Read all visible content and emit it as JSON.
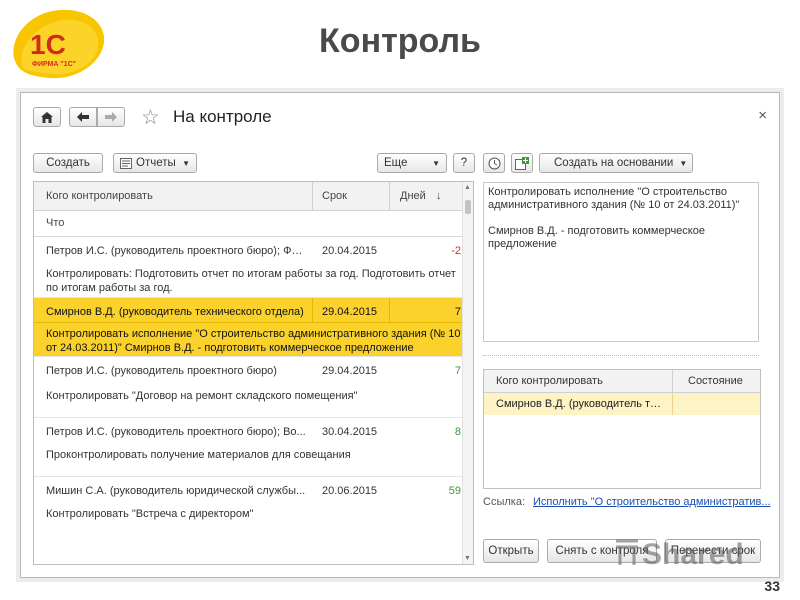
{
  "slide": {
    "title": "Контроль",
    "page_number": "33",
    "logo_text": "1С",
    "logo_sub": "ФИРМА \"1С\""
  },
  "window": {
    "title": "На контроле",
    "close_glyph": "×",
    "toolbar_left": {
      "create": "Создать",
      "reports": "Отчеты",
      "more": "Еще",
      "help": "?"
    },
    "toolbar_right": {
      "create_based": "Создать на основании"
    }
  },
  "list": {
    "columns": {
      "who": "Кого контролировать",
      "deadline": "Срок",
      "days": "Дней",
      "sort": "↓"
    },
    "subheader": "Что",
    "rows": [
      {
        "who": "Петров И.С. (руководитель проектного бюро); Фе...",
        "date": "20.04.2015",
        "days": "-2",
        "desc": "Контролировать: Подготовить отчет по итогам работы за год. Подготовить отчет по итогам работы за год."
      },
      {
        "who": "Смирнов В.Д. (руководитель технического отдела)",
        "date": "29.04.2015",
        "days": "7",
        "desc": "Контролировать исполнение \"О строительство административного здания (№ 10 от 24.03.2011)\" Смирнов В.Д. - подготовить коммерческое предложение"
      },
      {
        "who": "Петров И.С. (руководитель проектного бюро)",
        "date": "29.04.2015",
        "days": "7",
        "desc": "Контролировать \"Договор на ремонт складского помещения\""
      },
      {
        "who": "Петров И.С. (руководитель проектного бюро); Во...",
        "date": "30.04.2015",
        "days": "8",
        "desc": "Проконтролировать получение материалов для совещания"
      },
      {
        "who": "Мишин С.А. (руководитель юридической службы...",
        "date": "20.06.2015",
        "days": "59",
        "desc": "Контролировать \"Встреча с директором\""
      }
    ]
  },
  "detail": {
    "line1": "Контролировать исполнение \"О строительство административного здания (№ 10 от 24.03.2011)\"",
    "line2": "Смирнов В.Д. - подготовить коммерческое предложение"
  },
  "control_table": {
    "col_who": "Кого контролировать",
    "col_state": "Состояние",
    "row_who": "Смирнов В.Д. (руководитель те..."
  },
  "link": {
    "label": "Ссылка:",
    "value": "Исполнить \"О строительство административ..."
  },
  "bottom_buttons": {
    "open": "Открыть",
    "remove": "Снять с контроля",
    "move": "Перенести срок"
  },
  "watermark": "Shared",
  "colors": {
    "selected_row": "#fbd12c",
    "selected_control_row": "#fdf3c4",
    "negative": "#c0392b",
    "positive": "#3a9a3a",
    "link": "#1a4fb5"
  }
}
